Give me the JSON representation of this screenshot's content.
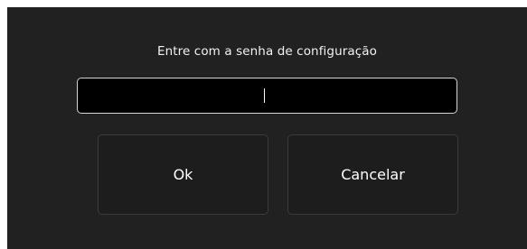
{
  "dialog": {
    "prompt": "Entre com a senha de configuração",
    "password": {
      "value": "",
      "placeholder": ""
    },
    "buttons": {
      "ok_label": "Ok",
      "cancel_label": "Cancelar"
    }
  },
  "colors": {
    "background": "#212121",
    "input_background": "#000000",
    "input_border": "#d4d4d4",
    "button_border": "#3b3b3b",
    "text": "#ffffff"
  }
}
